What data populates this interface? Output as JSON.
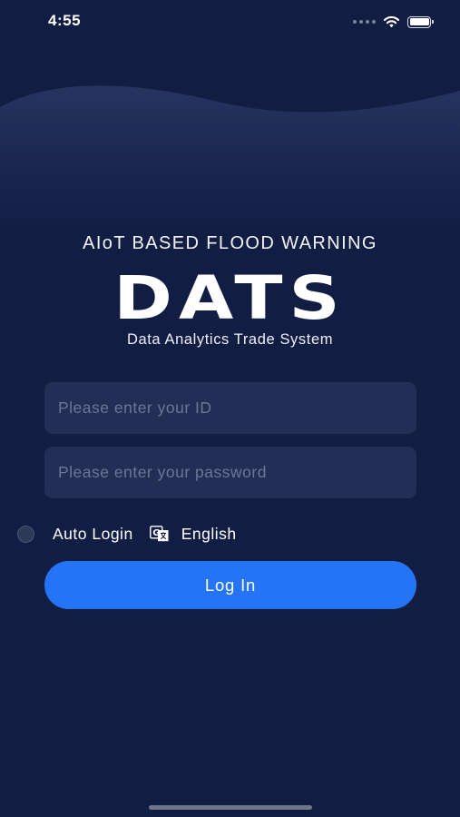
{
  "status_bar": {
    "time": "4:55"
  },
  "branding": {
    "headline": "AIoT BASED FLOOD WARNING",
    "logo_text": "DATS",
    "tagline": "Data Analytics Trade System"
  },
  "login_form": {
    "id_placeholder": "Please enter your ID",
    "id_value": "",
    "password_placeholder": "Please enter your password",
    "password_value": "",
    "auto_login_label": "Auto Login",
    "auto_login_checked": false,
    "language_label": "English",
    "login_button_label": "Log In"
  },
  "icons": {
    "status": [
      "signal-dots-icon",
      "wifi-icon",
      "battery-icon"
    ],
    "language": "translate-icon"
  },
  "colors": {
    "background": "#121d44",
    "wave": "#1f2c58",
    "input_background": "#222e56",
    "placeholder": "#6d7696",
    "primary_button": "#2474f5",
    "text": "#ffffff"
  }
}
